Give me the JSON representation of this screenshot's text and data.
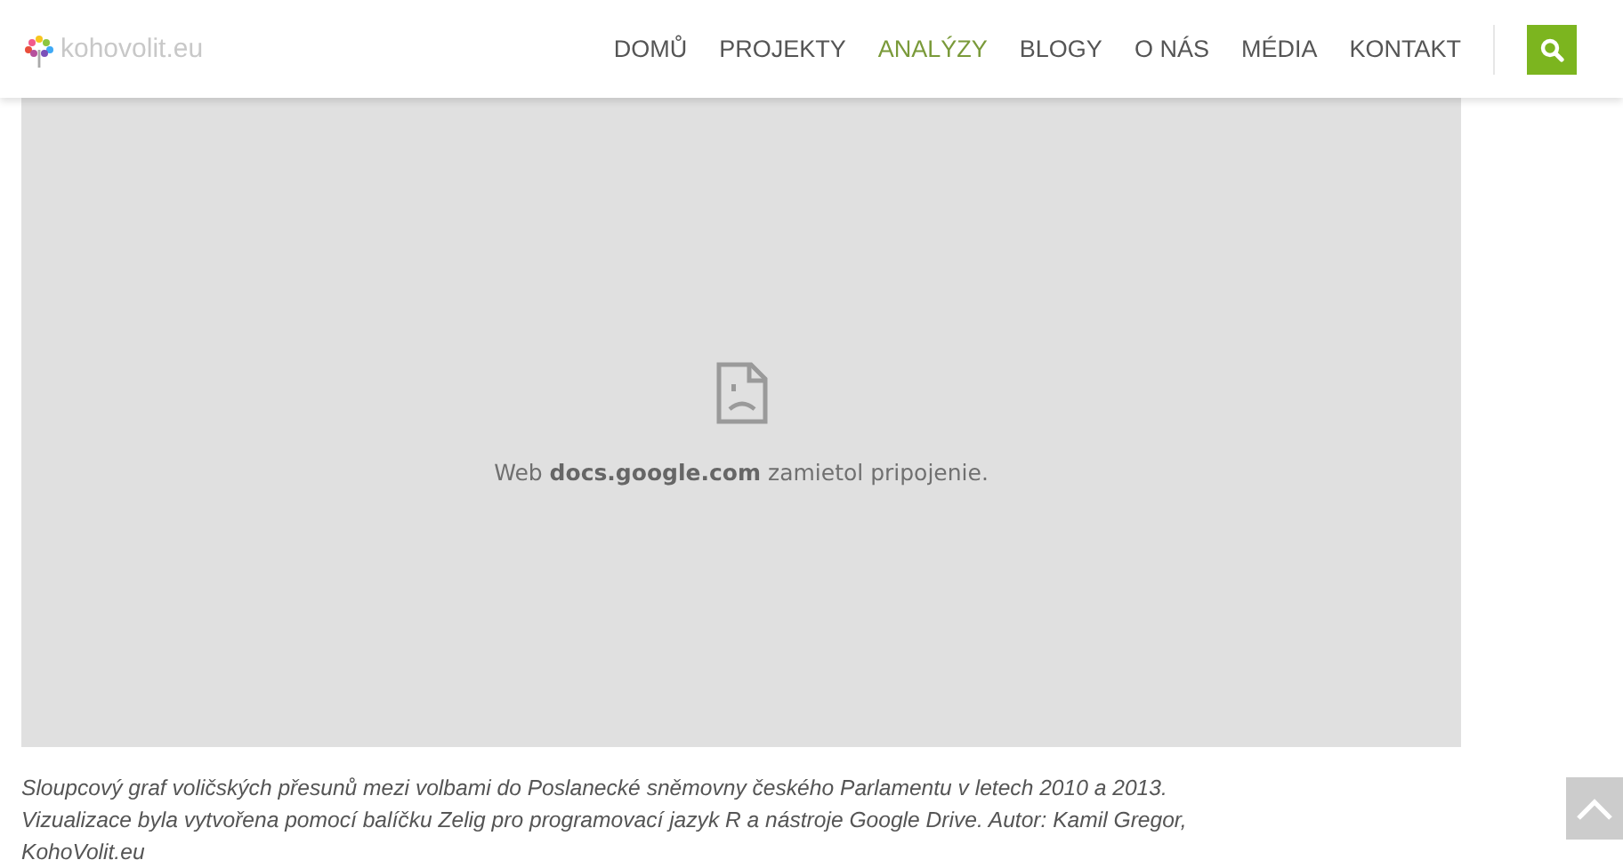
{
  "header": {
    "logo": "kohovolit.eu",
    "nav": [
      {
        "label": "DOMŮ",
        "selected": false
      },
      {
        "label": "PROJEKTY",
        "selected": false
      },
      {
        "label": "ANALÝZY",
        "selected": true
      },
      {
        "label": "BLOGY",
        "selected": false
      },
      {
        "label": "O NÁS",
        "selected": false
      },
      {
        "label": "MÉDIA",
        "selected": false
      },
      {
        "label": "KONTAKT",
        "selected": false
      }
    ]
  },
  "embed": {
    "message": "Web **docs.google.com** zamietol pripojenie."
  },
  "caption": "Sloupcový graf voličských přesunů mezi volbami do Poslanecké sněmovny českého Parlamentu v letech 2010 a 2013. Vizualizace byla vytvořena pomocí balíčku Zelig pro programovací jazyk R a nástroje Google Drive. Autor: Kamil Gregor, KohoVolit.eu"
}
